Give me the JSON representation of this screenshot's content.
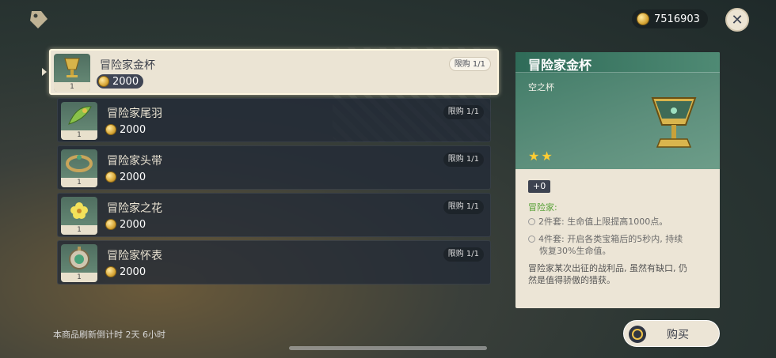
{
  "header": {
    "mora_amount": "7516903",
    "icons": {
      "shop": "price-tag-icon",
      "currency": "mora-coin-icon",
      "close": "close-icon"
    }
  },
  "items": [
    {
      "name": "冒险家金杯",
      "price": "2000",
      "limit": "限购 1/1",
      "qty": "1",
      "selected": true,
      "icon": "goblet-icon"
    },
    {
      "name": "冒险家尾羽",
      "price": "2000",
      "limit": "限购 1/1",
      "qty": "1",
      "selected": false,
      "icon": "feather-icon"
    },
    {
      "name": "冒险家头带",
      "price": "2000",
      "limit": "限购 1/1",
      "qty": "1",
      "selected": false,
      "icon": "headband-icon"
    },
    {
      "name": "冒险家之花",
      "price": "2000",
      "limit": "限购 1/1",
      "qty": "1",
      "selected": false,
      "icon": "flower-icon"
    },
    {
      "name": "冒险家怀表",
      "price": "2000",
      "limit": "限购 1/1",
      "qty": "1",
      "selected": false,
      "icon": "pocket-watch-icon"
    }
  ],
  "detail": {
    "title": "冒险家金杯",
    "type": "空之杯",
    "stars": "★★",
    "rarity": 2,
    "level": "+0",
    "set_name": "冒险家:",
    "bonus_2": "2件套: 生命值上限提高1000点。",
    "bonus_4_line1": "4件套: 开启各类宝箱后的5秒内, 持续",
    "bonus_4_line2": "恢复30%生命值。",
    "desc_line1": "冒险家某次出征的战利品, 虽然有缺口, 仍",
    "desc_line2": "然是值得骄傲的猎获。",
    "set_color": "#5aa23a"
  },
  "footer": {
    "refresh_text": "本商品刷新倒计时 2天 6小时",
    "buy_label": "购买"
  },
  "colors": {
    "accent_green": "#3f7a66",
    "gold": "#ffcc33",
    "panel": "#ece5d6"
  }
}
